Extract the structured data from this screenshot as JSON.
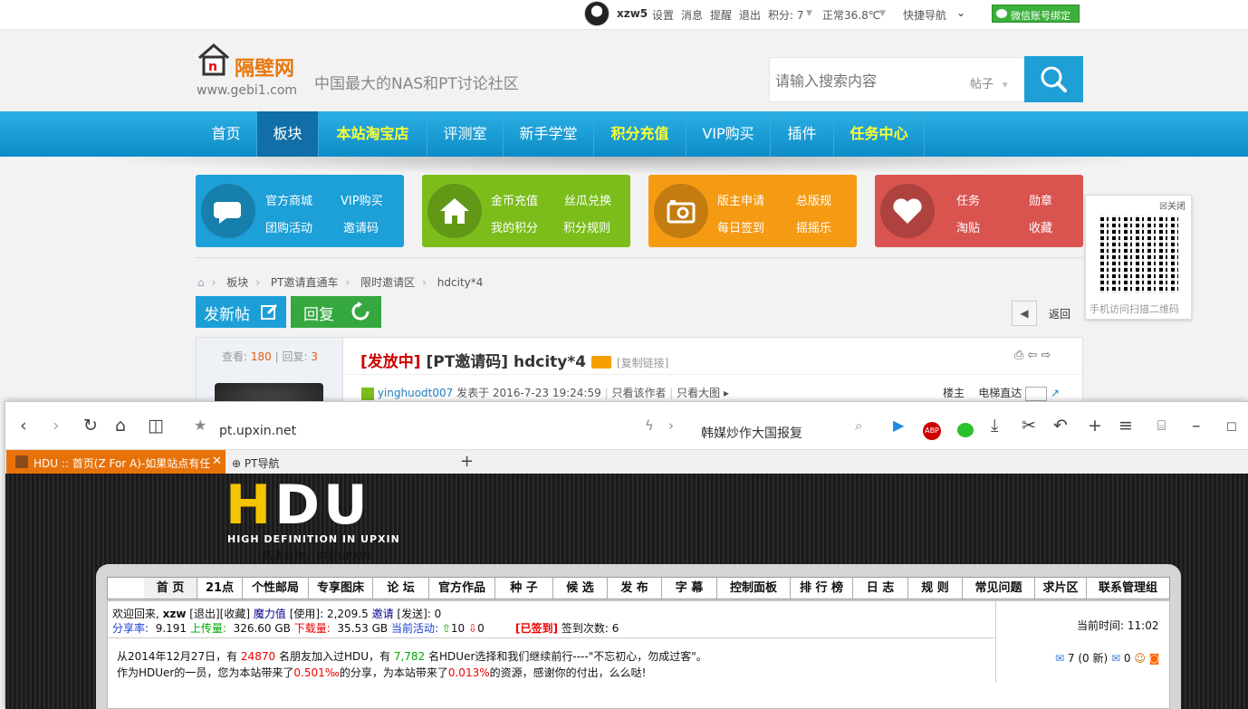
{
  "userbar": {
    "username": "xzw5",
    "links": [
      "设置",
      "消息",
      "提醒",
      "退出"
    ],
    "points": "积分: 7",
    "temp": "正常36.8℃",
    "quicknav": "快捷导航",
    "wechat_bind": "微信账号绑定"
  },
  "header": {
    "brand": "隔壁网",
    "domain": "www.gebi1.com",
    "slogan": "中国最大的NAS和PT讨论社区",
    "search_placeholder": "请输入搜索内容",
    "search_type": "帖子"
  },
  "nav": [
    "首页",
    "板块",
    "本站淘宝店",
    "评测室",
    "新手学堂",
    "积分充值",
    "VIP购买",
    "插件",
    "任务中心"
  ],
  "quick": [
    {
      "links": [
        "官方商城",
        "VIP购买",
        "团购活动",
        "邀请码"
      ],
      "color": "#1d9fd7"
    },
    {
      "links": [
        "金币充值",
        "丝瓜兑换",
        "我的积分",
        "积分规则"
      ],
      "color": "#7cbd1c"
    },
    {
      "links": [
        "版主申请",
        "总版规",
        "每日签到",
        "摇摇乐"
      ],
      "color": "#f59a13"
    },
    {
      "links": [
        "任务",
        "勋章",
        "淘贴",
        "收藏"
      ],
      "color": "#d9534f"
    }
  ],
  "qr": {
    "close": "关闭",
    "caption": "手机访问扫描二维码"
  },
  "breadcrumbs": [
    "板块",
    "PT邀请直通车",
    "限时邀请区",
    "hdcity*4"
  ],
  "actions": {
    "post": "发新帖",
    "reply": "回复",
    "back": "返回"
  },
  "post": {
    "views_label": "查看:",
    "views": "180",
    "replies_label": "回复:",
    "replies": "3",
    "status": "[发放中]",
    "title": "[PT邀请码] hdcity*4",
    "copy_link": "[复制链接]",
    "author": "yinghuodt007",
    "posted": "发表于 2016-7-23 19:24:59",
    "only_author": "只看该作者",
    "large_img": "只看大图",
    "floor": "楼主",
    "jump": "电梯直达"
  },
  "browser": {
    "url": "pt.upxin.net",
    "search_text": "韩媒炒作大国报复",
    "tab1": "HDU :: 首页(Z For A)-如果站点有任",
    "tab2": "PT导航"
  },
  "hdu": {
    "logo_h": "H",
    "logo_du": "DU",
    "tagline": "HIGH DEFINITION IN UPXIN",
    "slogan_cn": "高清有你，你有UPXIN",
    "menu": [
      "首 页",
      "21点",
      "个性邮局",
      "专享图床",
      "论 坛",
      "官方作品",
      "种 子",
      "候 选",
      "发 布",
      "字 幕",
      "控制面板",
      "排 行 榜",
      "日 志",
      "规 则",
      "常见问题",
      "求片区",
      "联系管理组"
    ],
    "welcome": "欢迎回来,",
    "user": "xzw",
    "logout": "[退出]",
    "fav": "[收藏]",
    "magic": "魔力值",
    "use": "[使用]: 2,209.5",
    "invite": "邀请",
    "send": "[发送]: 0",
    "ratio_label": "分享率:",
    "ratio": "9.191",
    "up_label": "上传量:",
    "up": "326.60 GB",
    "down_label": "下载量:",
    "down": "35.53 GB",
    "active_label": "当前活动:",
    "seeding": "10",
    "leeching": "0",
    "signed": "[已签到]",
    "sign_count": "签到次数: 6",
    "time_label": "当前时间:",
    "time": "11:02",
    "msg": "7 (0 新)",
    "msg2": "0",
    "line3a": "从2014年12月27日，有",
    "friends": "24870",
    "line3b": "名朋友加入过HDU，有",
    "remain": "7,782",
    "line3c": "名HDUer选择和我们继续前行----\"不忘初心，勿成过客\"。",
    "line4a": "作为HDUer的一员，您为本站带来了",
    "share": "0.501‰",
    "line4b": "的分享，为本站带来了",
    "res": "0.013%",
    "line4c": "的资源，感谢你的付出，么么哒!"
  }
}
